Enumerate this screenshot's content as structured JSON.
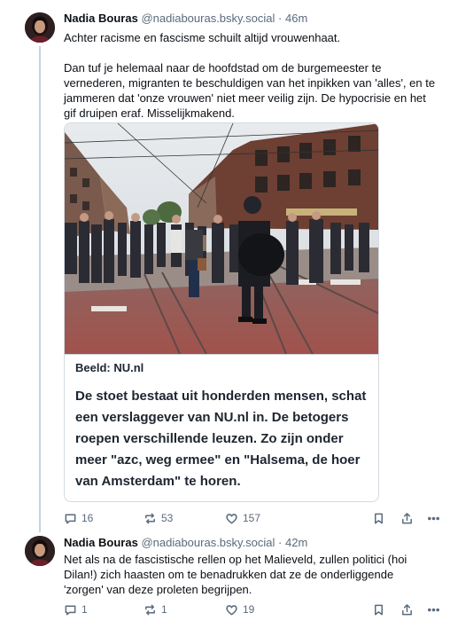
{
  "posts": [
    {
      "author_name": "Nadia Bouras",
      "handle": "@nadiabouras.bsky.social",
      "separator": "·",
      "time": "46m",
      "paragraphs": [
        "Achter racisme en fascisme schuilt altijd vrouwenhaat.",
        "Dan tuf je helemaal naar de hoofdstad om de burgemeester te vernederen, migranten te beschuldigen van het inpikken van 'alles', en te jammeren dat 'onze vrouwen' niet meer veilig zijn. De hypocrisie en het gif druipen eraf. Misselijkmakend."
      ],
      "link_card": {
        "source": "Beeld: NU.nl",
        "body": "De stoet bestaat uit honderden mensen, schat een verslaggever van NU.nl in. De betogers roepen verschillende leuzen. Zo zijn onder meer \"azc, weg ermee\" en \"Halsema, de hoer van Amsterdam\" te horen."
      },
      "counts": {
        "replies": "16",
        "reposts": "53",
        "likes": "157"
      }
    },
    {
      "author_name": "Nadia Bouras",
      "handle": "@nadiabouras.bsky.social",
      "separator": "·",
      "time": "42m",
      "paragraphs": [
        "Net als na de fascistische rellen op het Malieveld, zullen politici (hoi Dilan!) zich haasten om te benadrukken dat ze de onderliggende 'zorgen' van deze proleten begrijpen."
      ],
      "counts": {
        "replies": "1",
        "reposts": "1",
        "likes": "19"
      }
    }
  ],
  "icons": {
    "reply": "speech-bubble-icon",
    "repost": "repost-arrows-icon",
    "like": "heart-outline-icon",
    "save": "bookmark-icon",
    "share": "share-upload-icon",
    "more": "ellipsis-icon"
  },
  "colors": {
    "text": "#0b0f14",
    "muted": "#5b6b7c",
    "border": "#d4dbe2",
    "thread_line": "#c9d3dc"
  }
}
